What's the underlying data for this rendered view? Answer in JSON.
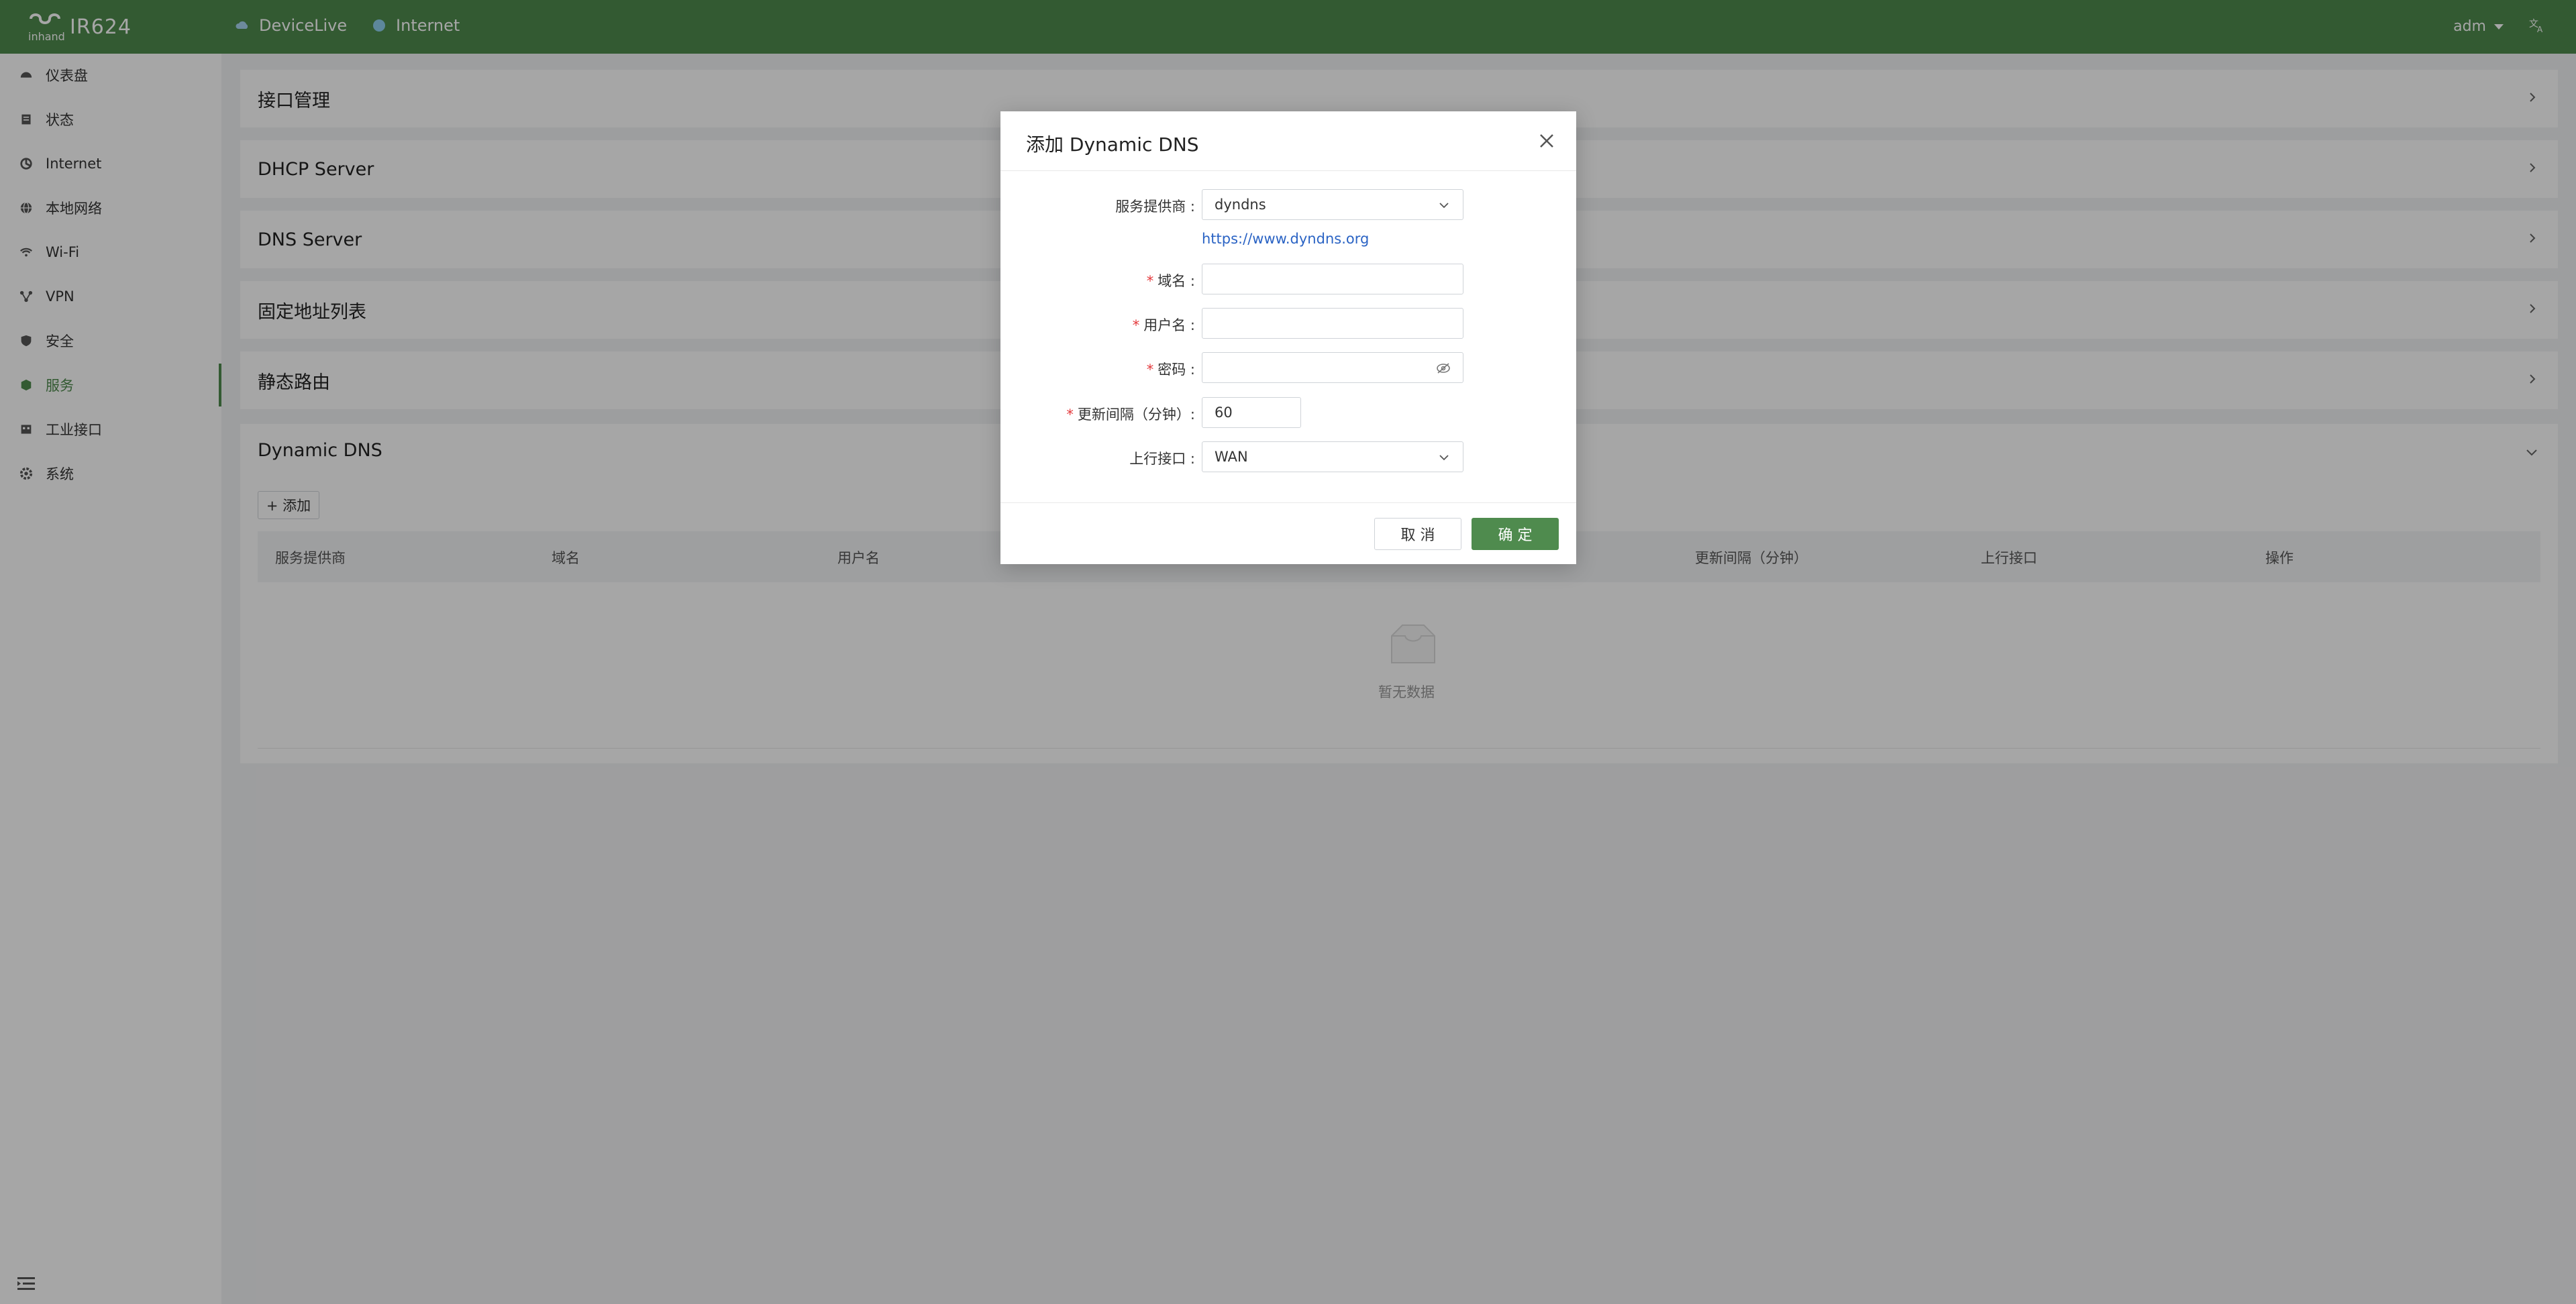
{
  "header": {
    "brand": "IR624",
    "logo_mark_text": "inhand",
    "links": [
      "DeviceLive",
      "Internet"
    ],
    "user": "adm",
    "lang_icon": "translate-icon"
  },
  "sidebar": {
    "items": [
      {
        "label": "仪表盘",
        "icon": "dashboard-icon"
      },
      {
        "label": "状态",
        "icon": "status-icon"
      },
      {
        "label": "Internet",
        "icon": "internet-icon"
      },
      {
        "label": "本地网络",
        "icon": "globe-icon"
      },
      {
        "label": "Wi-Fi",
        "icon": "wifi-icon"
      },
      {
        "label": "VPN",
        "icon": "vpn-icon"
      },
      {
        "label": "安全",
        "icon": "shield-icon"
      },
      {
        "label": "服务",
        "icon": "service-icon"
      },
      {
        "label": "工业接口",
        "icon": "industrial-icon"
      },
      {
        "label": "系统",
        "icon": "gear-icon"
      }
    ],
    "active": "服务"
  },
  "panels": [
    "接口管理",
    "DHCP Server",
    "DNS Server",
    "固定地址列表",
    "静态路由"
  ],
  "ddns": {
    "title": "Dynamic DNS",
    "add_label": "+ 添加",
    "columns": [
      "服务提供商",
      "域名",
      "用户名",
      "更新间隔（分钟）",
      "上行接口",
      "操作"
    ],
    "empty_text": "暂无数据"
  },
  "modal": {
    "title": "添加 Dynamic DNS",
    "fields": {
      "provider_label": "服务提供商 :",
      "provider_value": "dyndns",
      "provider_link": "https://www.dyndns.org",
      "domain_label": "域名 :",
      "username_label": "用户名 :",
      "password_label": "密码 :",
      "interval_label": "更新间隔（分钟）:",
      "interval_value": "60",
      "uplink_label": "上行接口 :",
      "uplink_value": "WAN"
    },
    "required_mark": "*",
    "cancel_label": "取 消",
    "ok_label": "确 定"
  }
}
